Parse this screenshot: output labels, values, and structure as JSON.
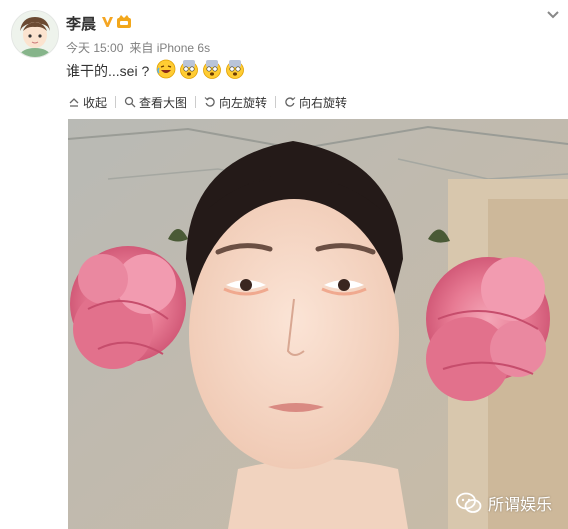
{
  "post": {
    "author": "李晨",
    "time": "今天 15:00",
    "source": "来自 iPhone 6s",
    "text": "谁干的...sei ?",
    "emojis": [
      "laughing-cry-emoji",
      "shocked-emoji",
      "shocked-emoji",
      "shocked-emoji"
    ]
  },
  "toolbar": {
    "collapse": "收起",
    "view_large": "查看大图",
    "rotate_left": "向左旋转",
    "rotate_right": "向右旋转"
  },
  "photo": {
    "watermark": "所谓娱乐"
  },
  "colors": {
    "text": "#333333",
    "meta": "#808080",
    "verified": "#f5a623",
    "vip": "#f2a71b"
  }
}
